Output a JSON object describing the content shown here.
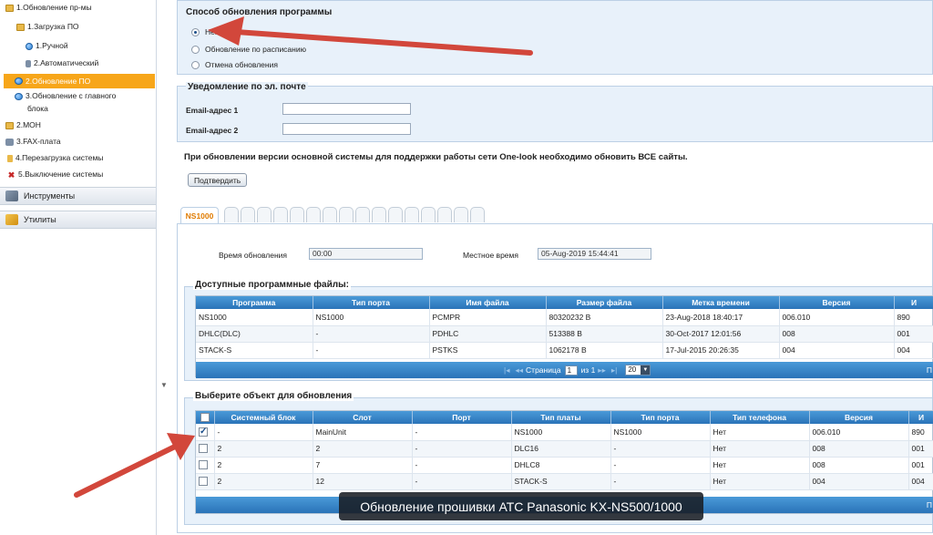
{
  "sidebar": {
    "items": [
      {
        "label": "1.Обновление пр-мы",
        "icon": "folder-icon"
      },
      {
        "label": "1.Загрузка ПО",
        "icon": "folder-icon"
      },
      {
        "label": "1.Ручной",
        "icon": "manual-icon"
      },
      {
        "label": "2.Автоматический",
        "icon": "auto-icon"
      },
      {
        "label": "2.Обновление ПО",
        "icon": "globe-icon"
      },
      {
        "label": "3.Обновление с главного",
        "icon": "globe-icon"
      },
      {
        "label": "блока",
        "icon": ""
      },
      {
        "label": "2.MOH",
        "icon": "folder-icon"
      },
      {
        "label": "3.FAX-плата",
        "icon": "fax-icon"
      },
      {
        "label": "4.Перезагрузка системы",
        "icon": "restart-icon"
      },
      {
        "label": "5.Выключение системы",
        "icon": "shutdown-icon"
      }
    ],
    "sections": [
      {
        "label": "Инструменты",
        "icon": "tools-icon"
      },
      {
        "label": "Утилиты",
        "icon": "utilities-icon"
      }
    ],
    "scroll_arrow": "▼"
  },
  "update_method": {
    "title": "Способ обновления программы",
    "options": [
      "Немедленно",
      "Обновление по расписанию",
      "Отмена обновления"
    ],
    "selected": "Немедленно"
  },
  "email": {
    "title": "Уведомление по эл. почте",
    "field1_label": "Email-адрес 1",
    "field1_value": "",
    "field2_label": "Email-адрес 2",
    "field2_value": ""
  },
  "notice": "При обновлении версии основной системы для поддержки работы сети One-look необходимо обновить ВСЕ сайты.",
  "confirm_button": "Подтвердить",
  "tabs": {
    "active": "NS1000"
  },
  "times": {
    "update_label": "Время обновления",
    "update_value": "00:00",
    "local_label": "Местное время",
    "local_value": "05-Aug-2019 15:44:41"
  },
  "files": {
    "title": "Доступные программные файлы:",
    "columns": [
      "Программа",
      "Тип порта",
      "Имя файла",
      "Размер файла",
      "Метка времени",
      "Версия",
      "И"
    ],
    "rows": [
      [
        "NS1000",
        "NS1000",
        "PCMPR",
        "80320232 B",
        "23-Aug-2018 18:40:17",
        "006.010",
        "890"
      ],
      [
        "DHLC(DLC)",
        "-",
        "PDHLC",
        "513388 B",
        "30-Oct-2017 12:01:56",
        "008",
        "001"
      ],
      [
        "STACK-S",
        "-",
        "PSTKS",
        "1062178 B",
        "17-Jul-2015 20:26:35",
        "004",
        "004"
      ]
    ],
    "pager": {
      "first": "|◂",
      "prev": "◂◂",
      "page_label": "Страница",
      "page_value": "1",
      "of_label": "из 1",
      "next": "▸▸",
      "last": "▸|",
      "per_page": "20",
      "right_marker": "П"
    }
  },
  "targets": {
    "title": "Выберите объект для обновления",
    "columns": [
      "",
      "Системный блок",
      "Слот",
      "Порт",
      "Тип платы",
      "Тип порта",
      "Тип телефона",
      "Версия",
      "И"
    ],
    "rows": [
      {
        "checked": true,
        "cells": [
          "-",
          "MainUnit",
          "-",
          "NS1000",
          "NS1000",
          "Нет",
          "006.010",
          "890"
        ]
      },
      {
        "checked": false,
        "cells": [
          "2",
          "2",
          "-",
          "DLC16",
          "-",
          "Нет",
          "008",
          "001"
        ]
      },
      {
        "checked": false,
        "cells": [
          "2",
          "7",
          "-",
          "DHLC8",
          "-",
          "Нет",
          "008",
          "001"
        ]
      },
      {
        "checked": false,
        "cells": [
          "2",
          "12",
          "-",
          "STACK-S",
          "-",
          "Нет",
          "004",
          "004"
        ]
      }
    ],
    "pager_right_marker": "П"
  },
  "caption": "Обновление прошивки АТС Panasonic KX-NS500/1000",
  "colors": {
    "accent": "#f7a61a",
    "header_blue": "#2a73b8",
    "arrow_red": "#d2473b"
  }
}
